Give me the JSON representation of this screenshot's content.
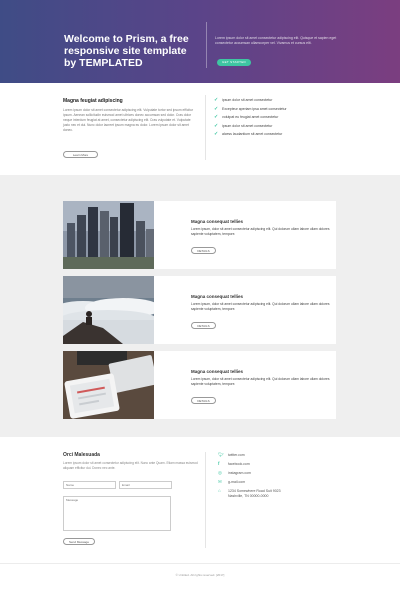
{
  "hero": {
    "title": "Welcome to Prism, a free responsive site template by TEMPLATED",
    "text": "Lorem ipsum dolor sit amet consectetur adipiscing elit. Quisque et sapien eget consectetur accumsan ullamcorper vel. Vivamus et cursus elit.",
    "button_label": "GET STARTED"
  },
  "intro": {
    "heading": "Magna feugiat adipiscing",
    "paragraph": "Lorem ipsum dolor sit amet consectetur adipiscing elit. Vulputate tortor sed ipsum efficitur ipsum. Aenean sollicitudin euismod amet ultrices donec accumsan sed dolor. Cras dolor neque interdum feugiat at amet, consectetur adipiscing elit. Cras vulputate et. Vulputate justo nec et dui. Nunc dolor laoreet ipsum magna eu dolor. Lorem ipsum dolor sit amet donec.",
    "button_label": "Learn More",
    "checklist": [
      "ipsum dolor sit amet consectetur",
      "Excepteur aperiam ipsa amet consectetur",
      "volutpat eu feugiat amet consectetur",
      "ipsum dolor sit amet consectetur",
      "alcess laudantium sit amet consectetur"
    ]
  },
  "features": [
    {
      "image": "city-skyline-photo",
      "title": "Magna consequat tellies",
      "text": "Lorem ipsum, dolor sit amet consectetur adipiscing elit. Qui dolorum ullam labore ullam dolores sapiente voluptatem, tempore.",
      "button_label": "DETAILS"
    },
    {
      "image": "man-above-clouds-photo",
      "title": "Magna consequat tellies",
      "text": "Lorem ipsum, dolor sit amet consectetur adipiscing elit. Qui dolorum ullam labore ullam dolores sapiente voluptatem, tempore.",
      "button_label": "DETAILS"
    },
    {
      "image": "tablet-keyboard-photo",
      "title": "Magna consequat tellies",
      "text": "Lorem ipsum, dolor sit amet consectetur adipiscing elit. Qui dolorum ullam labore ullam dolores sapiente voluptatem, tempore.",
      "button_label": "DETAILS"
    }
  ],
  "contact": {
    "heading": "Orci Malesuada",
    "paragraph": "Lorem ipsum dolor sit amet consectetur adipiscing elit. Nunc ante Quam. Etiam massa euismod aliquam efficitur dui. Donec nec ante.",
    "name_placeholder": "Name",
    "email_placeholder": "Email",
    "message_placeholder": "Message",
    "send_label": "Send Message",
    "info": [
      {
        "icon": "twitter-icon",
        "text": "twitter.com"
      },
      {
        "icon": "facebook-icon",
        "text": "facebook.com"
      },
      {
        "icon": "instagram-icon",
        "text": "instagram.com"
      },
      {
        "icon": "mail-icon",
        "text": "g-mail.com"
      }
    ],
    "address_line1": "1234 Somewhere Road Suit 9023",
    "address_line2": "Nashville, TN 00000-0000"
  },
  "footer": {
    "text": "© Untitled. All rights reserved. [2017]"
  },
  "colors": {
    "accent": "#3ec6a2",
    "hero_start": "#3f4c86",
    "hero_end": "#7b3e80"
  }
}
